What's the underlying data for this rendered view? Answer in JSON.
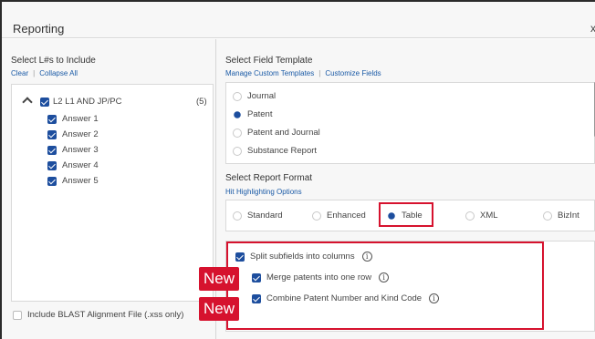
{
  "dialog": {
    "title": "Reporting",
    "close_symbol": "x"
  },
  "left_panel": {
    "heading": "Select L#s to Include",
    "links": {
      "clear": "Clear",
      "collapse_all": "Collapse All"
    },
    "tree": {
      "label": "L2  L1 AND JP/PC",
      "count": "(5)",
      "answers": [
        "Answer 1",
        "Answer 2",
        "Answer 3",
        "Answer 4",
        "Answer 5"
      ]
    },
    "blast_option": "Include BLAST Alignment File (.xss only)"
  },
  "field_template": {
    "heading": "Select Field Template",
    "links": {
      "manage": "Manage Custom Templates",
      "customize": "Customize Fields"
    },
    "options": [
      "Journal",
      "Patent",
      "Patent and Journal",
      "Substance Report"
    ],
    "selected": "Patent"
  },
  "report_format": {
    "heading": "Select Report Format",
    "link": "Hit Highlighting Options",
    "options": [
      "Standard",
      "Enhanced",
      "Table",
      "XML",
      "BizInt"
    ],
    "selected": "Table"
  },
  "table_options": {
    "split_subfields": "Split subfields into columns",
    "merge_patents": "Merge patents into one row",
    "combine_patent": "Combine Patent Number and Kind Code",
    "info_symbol": "i"
  },
  "badges": {
    "new_1": "New",
    "new_2": "New"
  },
  "colors": {
    "accent": "#1d4e9e",
    "link": "#1a5aa6",
    "highlight": "#d6122e"
  }
}
